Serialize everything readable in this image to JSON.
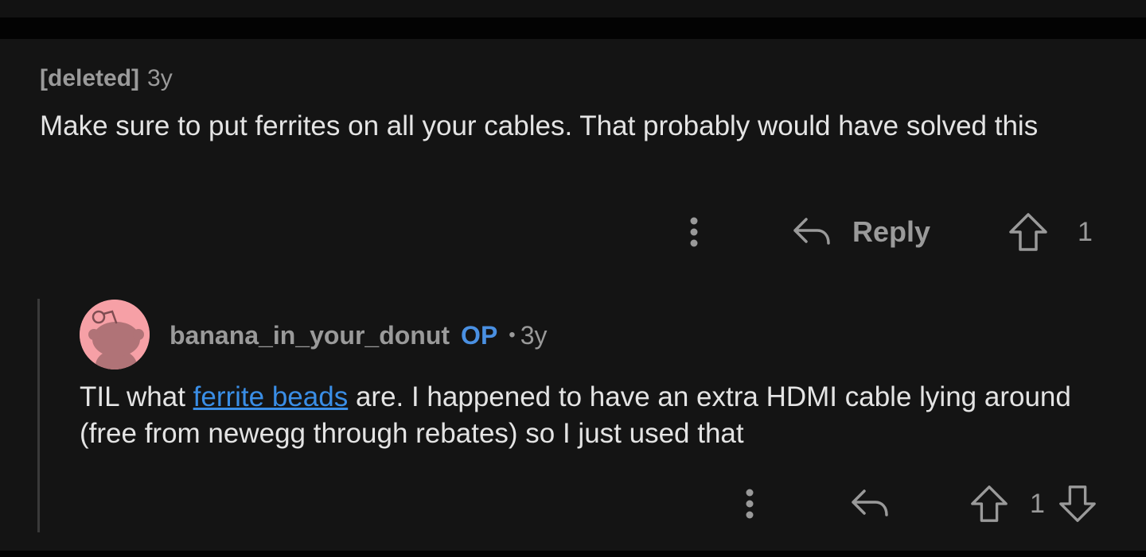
{
  "comment": {
    "author": "[deleted]",
    "age": "3y",
    "body": "Make sure to put ferrites on all your cables. That probably would have solved this",
    "actions": {
      "more_icon": "more-vertical-icon",
      "reply_icon": "reply-arrow-icon",
      "reply_label": "Reply",
      "upvote_icon": "upvote-arrow-icon",
      "score": "1"
    }
  },
  "reply": {
    "username": "banana_in_your_donut",
    "op_badge": "OP",
    "separator": "•",
    "age": "3y",
    "avatar_icon": "reddit-snoo-avatar",
    "body_before_link": "TIL what ",
    "link_text": "ferrite beads",
    "body_after_link": " are. I happened to have an extra HDMI cable lying around (free from newegg through rebates) so I just used that",
    "actions": {
      "more_icon": "more-vertical-icon",
      "reply_icon": "reply-arrow-icon",
      "upvote_icon": "upvote-arrow-icon",
      "score": "1",
      "downvote_icon": "downvote-arrow-icon"
    }
  },
  "colors": {
    "background": "#141414",
    "text": "#e4e4e4",
    "muted": "#9a9a9a",
    "op_blue": "#4a90e2",
    "link": "#3a8ee6",
    "avatar_bg": "#f6a0a6"
  }
}
